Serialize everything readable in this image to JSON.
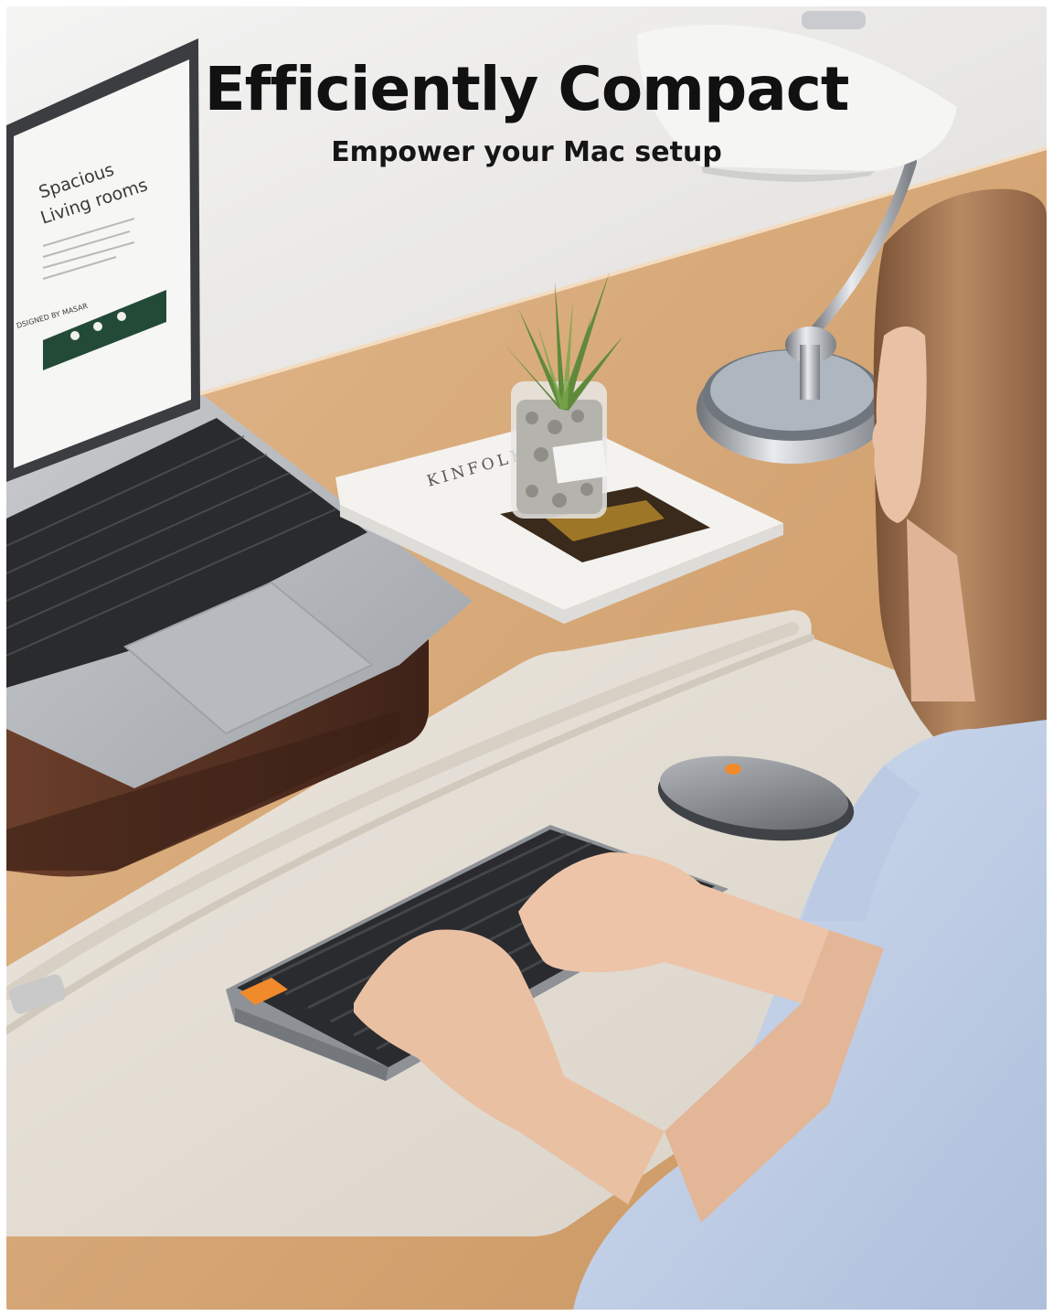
{
  "header": {
    "title": "Efficiently Compact",
    "subtitle": "Empower your Mac setup"
  },
  "laptop_screen": {
    "heading_line1": "Spacious",
    "heading_line2": "Living rooms",
    "footer": "DSIGNED BY MASAR"
  },
  "book": {
    "title": "KINFOLK"
  },
  "colors": {
    "accent_orange": "#f08a2b",
    "desk_wood": "#d6a77a",
    "desk_mat": "#e3ddd4",
    "walnut_stand": "#5a3424",
    "wall": "#ecebea",
    "shirt_blue": "#c7d6ec",
    "hair": "#9a6a4a"
  },
  "icons": [
    "plant-icon",
    "lamp-icon",
    "mouse-icon",
    "keyboard-icon",
    "laptop-icon"
  ]
}
